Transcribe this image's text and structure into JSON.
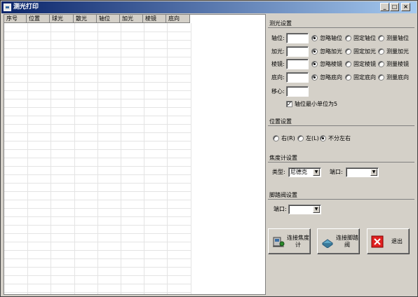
{
  "window": {
    "title": "测光打印"
  },
  "titlebar_buttons": {
    "minimize": "_",
    "maximize": "□",
    "close": "×"
  },
  "grid": {
    "columns": [
      "序号",
      "位置",
      "球光",
      "散光",
      "轴位",
      "加光",
      "棱镜",
      "底向"
    ]
  },
  "measure_settings": {
    "title": "测光设置",
    "rows": [
      {
        "label": "轴位:",
        "options": [
          "忽略轴位",
          "固定轴位",
          "测量轴位"
        ],
        "selected": 0
      },
      {
        "label": "加光:",
        "options": [
          "忽略加光",
          "固定加光",
          "测量加光"
        ],
        "selected": 0
      },
      {
        "label": "棱镜:",
        "options": [
          "忽略棱镜",
          "固定棱镜",
          "测量棱镜"
        ],
        "selected": 0
      },
      {
        "label": "底向:",
        "options": [
          "忽略底向",
          "固定底向",
          "测量底向"
        ],
        "selected": 0
      }
    ],
    "shift_label": "移心:",
    "axis_min_unit_label": "轴位最小单位为5",
    "axis_min_unit_checked": true
  },
  "position_settings": {
    "title": "位置设置",
    "options": [
      "右(R)",
      "左(L)",
      "不分左右"
    ],
    "selected": 2
  },
  "focimeter_settings": {
    "title": "焦度计设置",
    "type_label": "类型:",
    "type_value": "尼德克",
    "port_label": "端口:",
    "port_value": ""
  },
  "footpedal_settings": {
    "title": "脚踏阀设置",
    "port_label": "端口:",
    "port_value": ""
  },
  "actions": {
    "connect_focimeter": "连接焦度计",
    "connect_footpedal": "连接脚踏阀",
    "exit": "退出"
  }
}
